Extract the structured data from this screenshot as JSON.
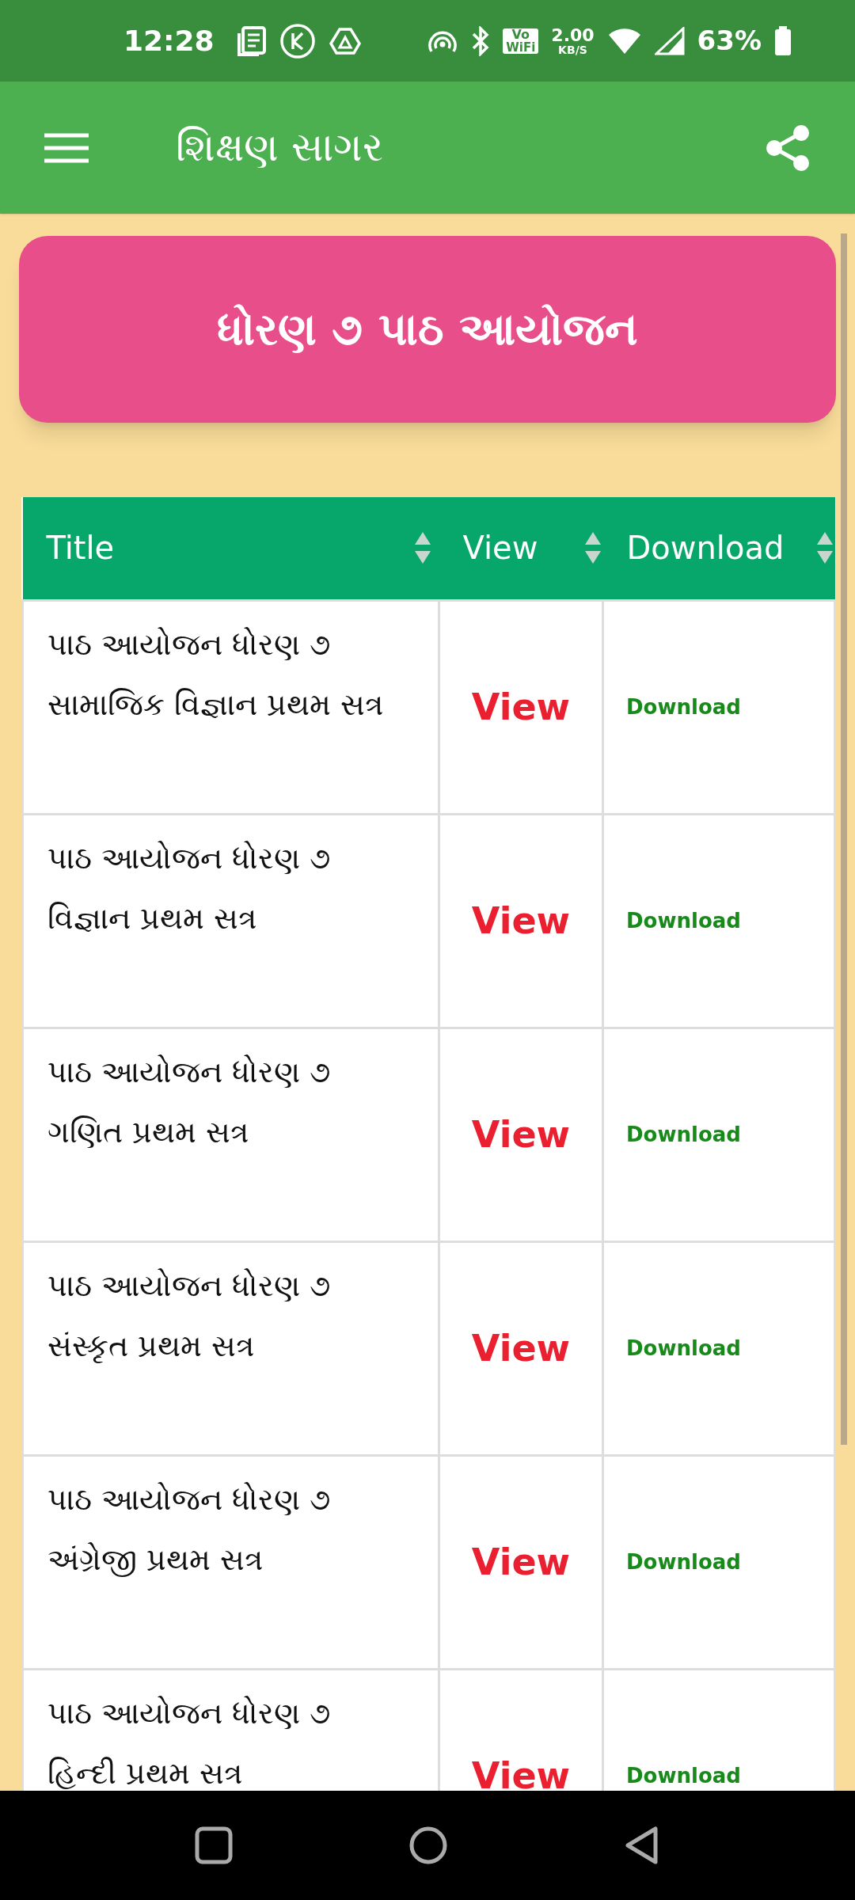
{
  "status_bar": {
    "time": "12:28",
    "vowifi_top": "Vo",
    "vowifi_bottom": "WiFi",
    "net_speed": "2.00",
    "net_unit": "KB/S",
    "battery": "63%"
  },
  "app_bar": {
    "title": "શિક્ષણ સાગર"
  },
  "banner": {
    "title": "ધોરણ ૭ પાઠ આયોજન"
  },
  "table": {
    "columns": [
      "Title",
      "View",
      "Download"
    ],
    "rows": [
      {
        "title": "પાઠ આયોજન ધોરણ ૭\nસામાજિક વિજ્ઞાન પ્રથમ સત્ર",
        "view": "View",
        "download": "Download"
      },
      {
        "title": "પાઠ આયોજન ધોરણ ૭\nવિજ્ઞાન પ્રથમ સત્ર",
        "view": "View",
        "download": "Download"
      },
      {
        "title": "પાઠ આયોજન ધોરણ ૭\nગણિત પ્રથમ સત્ર",
        "view": "View",
        "download": "Download"
      },
      {
        "title": "પાઠ આયોજન ધોરણ ૭\nસંસ્કૃત પ્રથમ સત્ર",
        "view": "View",
        "download": "Download"
      },
      {
        "title": "પાઠ આયોજન ધોરણ ૭\nઅંગ્રેજી પ્રથમ સત્ર",
        "view": "View",
        "download": "Download"
      },
      {
        "title": "પાઠ આયોજન ધોરણ ૭\nહિન્દી પ્રથમ સત્ર",
        "view": "View",
        "download": "Download"
      }
    ]
  }
}
